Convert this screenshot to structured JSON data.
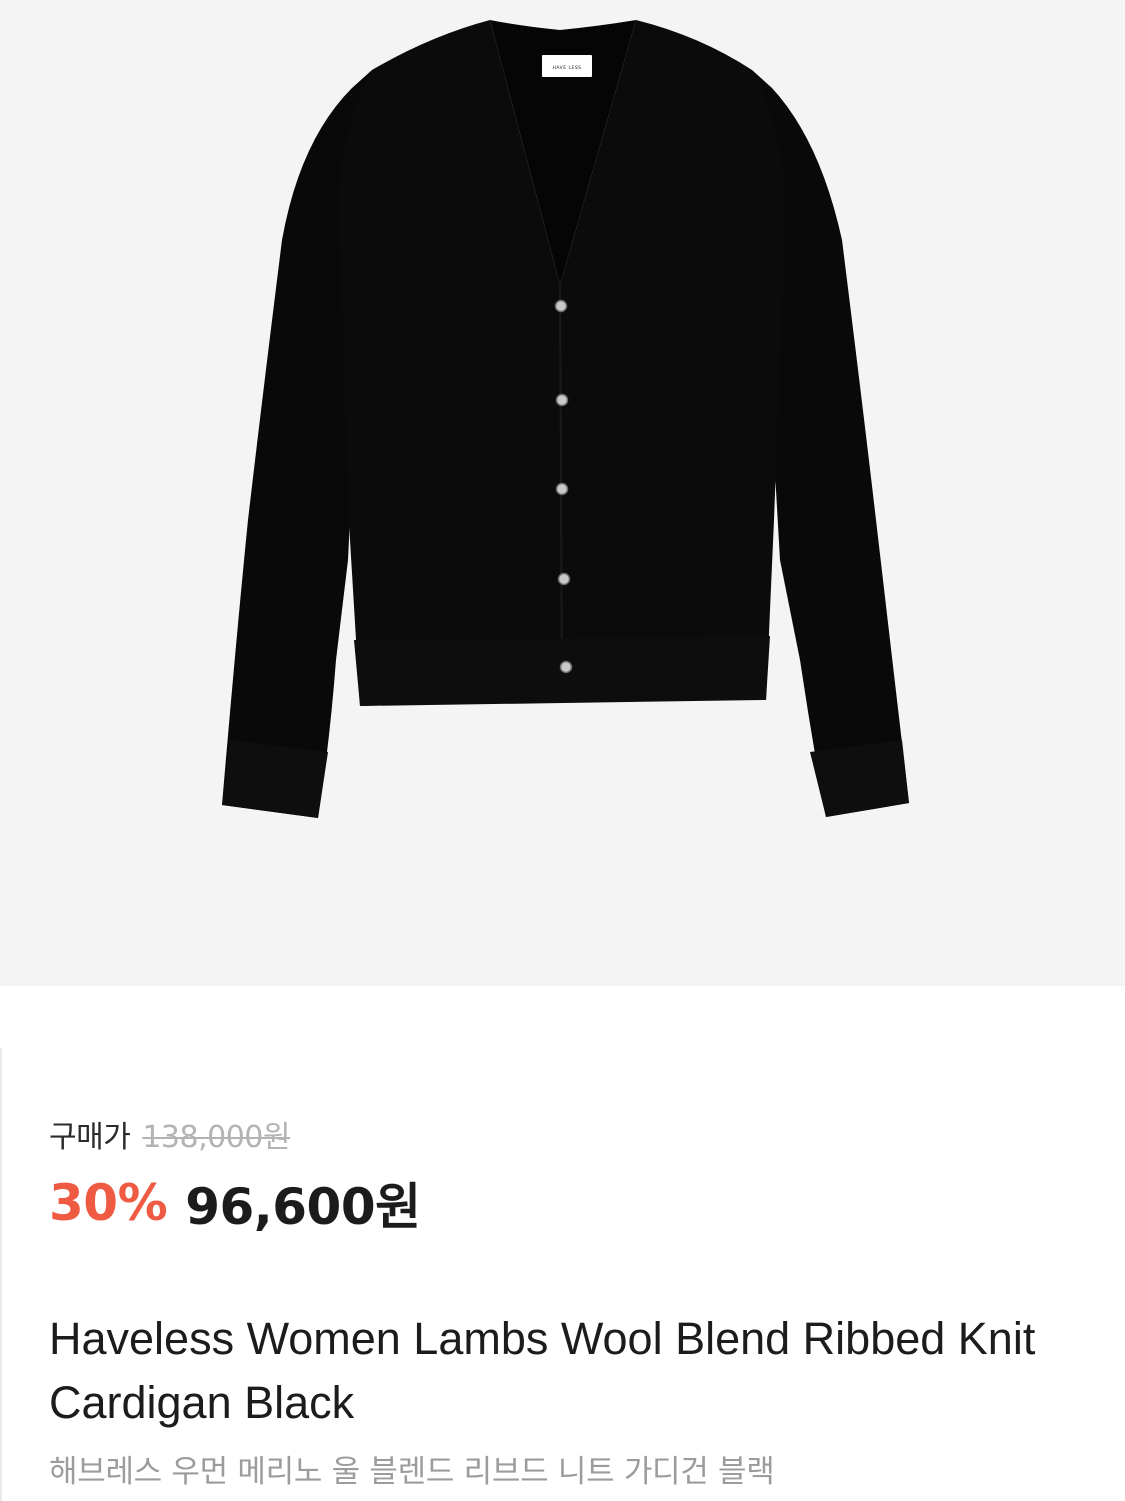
{
  "product": {
    "image_alt": "Black V-neck knit cardigan",
    "brand_tag": "HAVE LESS",
    "price_label": "구매가",
    "original_price": "138,000원",
    "discount": "30%",
    "sale_price": "96,600원",
    "title_en": "Haveless Women Lambs Wool Blend Ribbed Knit Cardigan Black",
    "title_ko": "해브레스 우먼 메리노 울 블렌드 리브드 니트 가디건 블랙"
  },
  "colors": {
    "hero_background": "#f4f4f4",
    "discount": "#ef5a43",
    "garment": "#0b0b0b"
  }
}
